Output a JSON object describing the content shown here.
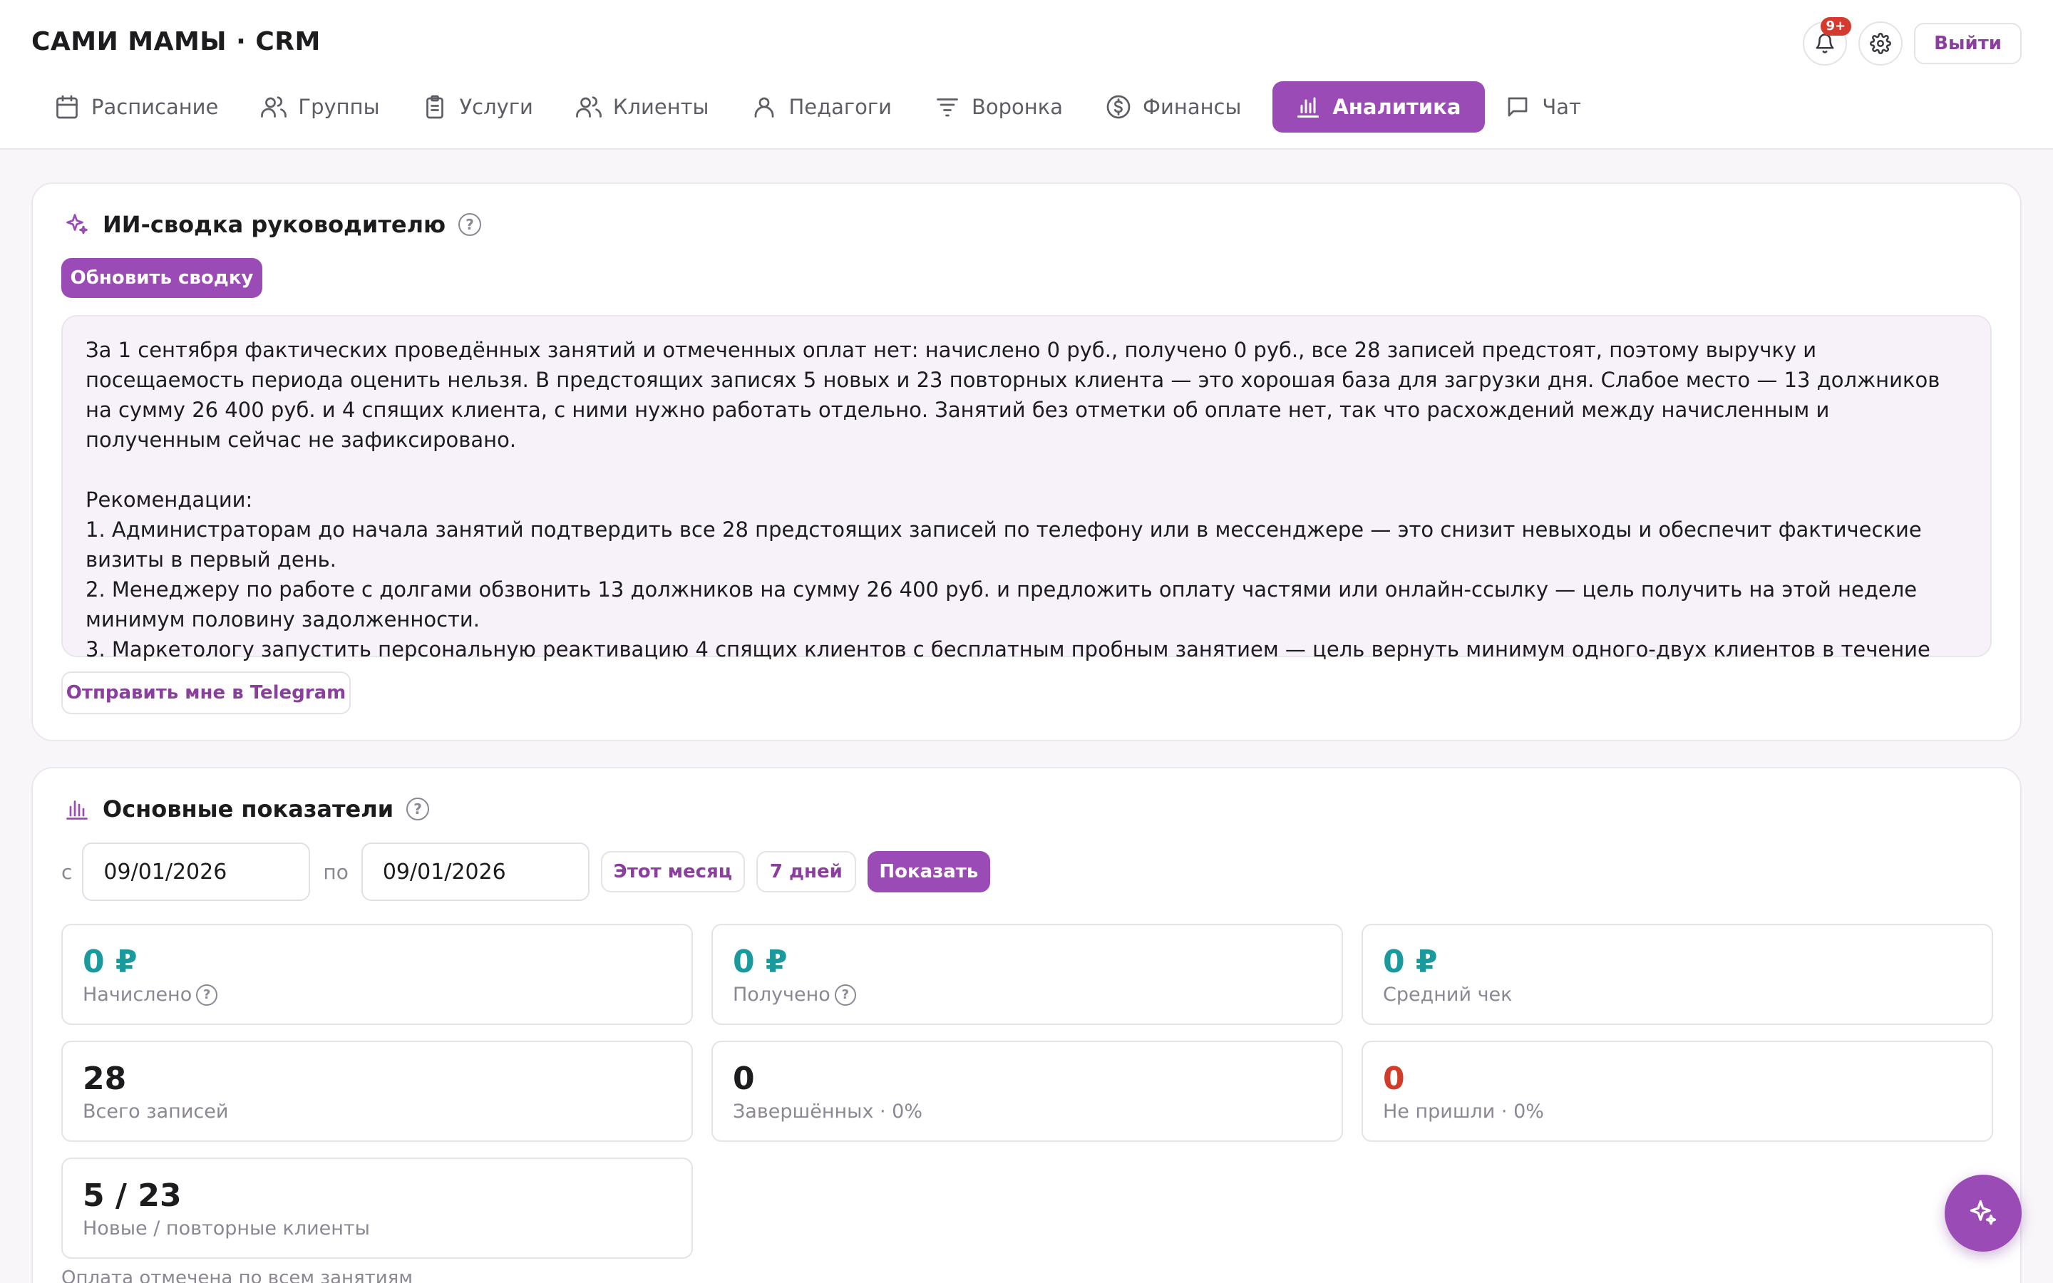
{
  "app": {
    "title": "САМИ МАМЫ · CRM"
  },
  "header": {
    "notifications_badge": "9+",
    "logout_label": "Выйти"
  },
  "nav": [
    {
      "label": "Расписание",
      "icon": "calendar-icon"
    },
    {
      "label": "Группы",
      "icon": "users-icon"
    },
    {
      "label": "Услуги",
      "icon": "clipboard-icon"
    },
    {
      "label": "Клиенты",
      "icon": "users-icon"
    },
    {
      "label": "Педагоги",
      "icon": "user-icon"
    },
    {
      "label": "Воронка",
      "icon": "filter-icon"
    },
    {
      "label": "Финансы",
      "icon": "dollar-circle-icon"
    },
    {
      "label": "Аналитика",
      "icon": "bar-chart-icon",
      "active": true
    },
    {
      "label": "Чат",
      "icon": "chat-icon"
    }
  ],
  "summary": {
    "title": "ИИ-сводка руководителю",
    "refresh_label": "Обновить сводку",
    "text": "За 1 сентября фактических проведённых занятий и отмеченных оплат нет: начислено 0 руб., получено 0 руб., все 28 записей предстоят, поэтому выручку и посещаемость периода оценить нельзя. В предстоящих записях 5 новых и 23 повторных клиента — это хорошая база для загрузки дня. Слабое место — 13 должников на сумму 26 400 руб. и 4 спящих клиента, с ними нужно работать отдельно. Занятий без отметки об оплате нет, так что расхождений между начисленным и полученным сейчас не зафиксировано.\n\nРекомендации:\n1. Администраторам до начала занятий подтвердить все 28 предстоящих записей по телефону или в мессенджере — это снизит невыходы и обеспечит фактические визиты в первый день.\n2. Менеджеру по работе с долгами обзвонить 13 должников на сумму 26 400 руб. и предложить оплату частями или онлайн-ссылку — цель получить на этой неделе минимум половину задолженности.\n3. Маркетологу запустить персональную реактивацию 4 спящих клиентов с бесплатным пробным занятием — цель вернуть минимум одного-двух клиентов в течение недели.",
    "telegram_label": "Отправить мне в Telegram"
  },
  "metrics": {
    "title": "Основные показатели",
    "from_label": "с",
    "from_value": "09/01/2026",
    "to_label": "по",
    "to_value": "09/01/2026",
    "this_month_label": "Этот месяц",
    "seven_days_label": "7 дней",
    "show_label": "Показать",
    "tiles": [
      {
        "value": "0 ₽",
        "label": "Начислено",
        "help": true,
        "style": "money"
      },
      {
        "value": "0 ₽",
        "label": "Получено",
        "help": true,
        "style": "money"
      },
      {
        "value": "0 ₽",
        "label": "Средний чек",
        "help": false,
        "style": "money"
      },
      {
        "value": "28",
        "label": "Всего записей",
        "help": false,
        "style": "dark"
      },
      {
        "value": "0",
        "label": "Завершённых · 0%",
        "help": false,
        "style": "dark"
      },
      {
        "value": "0",
        "label": "Не пришли · 0%",
        "help": false,
        "style": "red"
      },
      {
        "value": "5 / 23",
        "label": "Новые / повторные клиенты",
        "help": false,
        "style": "dark"
      }
    ],
    "footer_note": "Оплата отмечена по всем занятиям"
  },
  "colors": {
    "accent": "#9b4bb5",
    "money": "#1a9a9c",
    "danger": "#d03b2a"
  }
}
